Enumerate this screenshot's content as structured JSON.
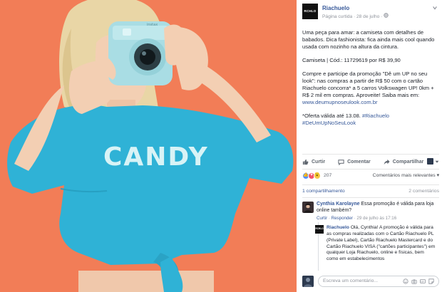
{
  "post": {
    "page_name": "Riachuelo",
    "avatar_text": "RCHLO",
    "meta": "Página curtida · 28 de julho · ",
    "text_1": "Uma peça para amar: a camiseta com detalhes de babados. Dica fashionista: fica ainda mais cool quando usada com nozinho na altura da cintura.",
    "text_2": "Camiseta | Cód.: 11729619 por R$ 39,90",
    "text_3": "Compre e participe da promoção \"Dê um UP no seu look\": nas compras a partir de R$ 50 com o cartão Riachuelo concorra* a 5 carros Volkswagen UP! 0km + R$ 2 mil em compras. Aproveite! Saiba mais em: ",
    "text_3_link": "www.deumupnoseulook.com.br",
    "text_4": "*Oferta válida até 13.08. ",
    "hashtag_1": "#Riachuelo",
    "hashtag_2": "#DeUmUpNoSeuLook"
  },
  "photo": {
    "shirt_text": "CANDY",
    "camera_brand": "instax",
    "colors": {
      "background": "#f27d57",
      "shirt": "#2fb2d6",
      "camera": "#a9dde4"
    }
  },
  "actions": {
    "like": "Curtir",
    "comment": "Comentar",
    "share": "Compartilhar"
  },
  "reactions": {
    "count": "207",
    "relevance_label": "Comentários mais relevantes"
  },
  "shares": {
    "left": "1 compartilhamento",
    "right": "2 comentários"
  },
  "comment_1": {
    "author": "Cynthia Karolayne",
    "text": "Essa promoção é válida para loja online também?",
    "like": "Curtir",
    "reply": "Responder",
    "time": "29 de julho às 17:16"
  },
  "reply_1": {
    "author": "Riachuelo",
    "avatar_text": "RCHLO",
    "text": "Olá, Cynthia! A promoção é válida para as compras realizadas com o Cartão Riachuelo PL (Private Label), Cartão Riachuelo Mastercard e do Cartão Riachuelo VISA (\"cartões participantes\") em qualquer Loja Riachuelo, online e físicas, bem como em estabelecimentos"
  },
  "write_comment": {
    "placeholder": "Escreva um comentário..."
  }
}
